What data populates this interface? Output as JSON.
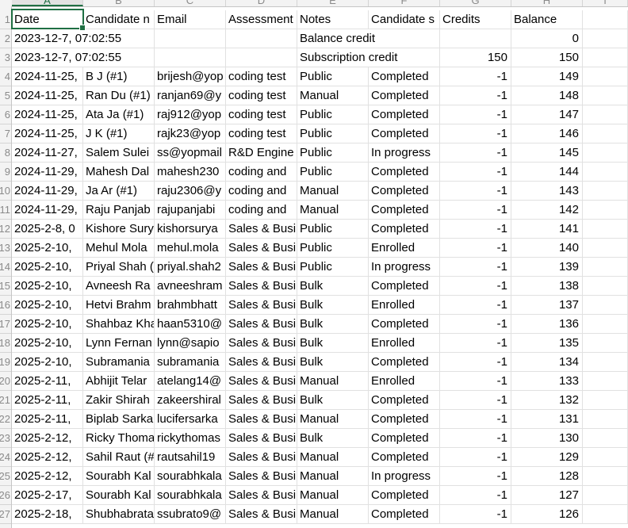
{
  "columns": [
    {
      "letter": "A"
    },
    {
      "letter": "B"
    },
    {
      "letter": "C"
    },
    {
      "letter": "D"
    },
    {
      "letter": "E"
    },
    {
      "letter": "F"
    },
    {
      "letter": "G"
    },
    {
      "letter": "H"
    },
    {
      "letter": "I"
    }
  ],
  "header": {
    "row_number": "1",
    "cells": [
      "Date",
      "Candidate n",
      "Email",
      "Assessment",
      "Notes",
      "Candidate s",
      "Credits",
      "Balance"
    ]
  },
  "rows": [
    {
      "n": "2",
      "cells": [
        "2023-12-7, 07:02:55",
        "",
        "",
        "",
        "Balance credit",
        "",
        "",
        "0"
      ]
    },
    {
      "n": "3",
      "cells": [
        "2023-12-7, 07:02:55",
        "",
        "",
        "",
        "Subscription credit",
        "",
        "150",
        "150"
      ]
    },
    {
      "n": "4",
      "cells": [
        "2024-11-25,",
        "B J (#1)",
        "brijesh@yop",
        "coding test",
        "Public",
        "Completed",
        "-1",
        "149"
      ]
    },
    {
      "n": "5",
      "cells": [
        "2024-11-25,",
        "Ran Du (#1)",
        "ranjan69@y",
        "coding test",
        "Manual",
        "Completed",
        "-1",
        "148"
      ]
    },
    {
      "n": "6",
      "cells": [
        "2024-11-25,",
        "Ata Ja (#1)",
        "raj912@yop",
        "coding test",
        "Public",
        "Completed",
        "-1",
        "147"
      ]
    },
    {
      "n": "7",
      "cells": [
        "2024-11-25,",
        "J K (#1)",
        "rajk23@yop",
        "coding test",
        "Public",
        "Completed",
        "-1",
        "146"
      ]
    },
    {
      "n": "8",
      "cells": [
        "2024-11-27,",
        "Salem Sulei",
        "ss@yopmail",
        "R&D Engine",
        "Public",
        "In progress",
        "-1",
        "145"
      ]
    },
    {
      "n": "9",
      "cells": [
        "2024-11-29,",
        "Mahesh Dal",
        "mahesh230",
        "coding and",
        "Public",
        "Completed",
        "-1",
        "144"
      ]
    },
    {
      "n": "10",
      "cells": [
        "2024-11-29,",
        "Ja Ar (#1)",
        "raju2306@y",
        "coding and",
        "Manual",
        "Completed",
        "-1",
        "143"
      ]
    },
    {
      "n": "11",
      "cells": [
        "2024-11-29,",
        "Raju Panjab",
        "rajupanjabi",
        "coding and",
        "Manual",
        "Completed",
        "-1",
        "142"
      ]
    },
    {
      "n": "12",
      "cells": [
        "2025-2-8, 0",
        "Kishore Sury",
        "kishorsurya",
        "Sales & Busi",
        "Public",
        "Completed",
        "-1",
        "141"
      ]
    },
    {
      "n": "13",
      "cells": [
        "2025-2-10,",
        "Mehul Mola",
        "mehul.mola",
        "Sales & Busi",
        "Public",
        "Enrolled",
        "-1",
        "140"
      ]
    },
    {
      "n": "14",
      "cells": [
        "2025-2-10,",
        "Priyal Shah (",
        "priyal.shah2",
        "Sales & Busi",
        "Public",
        "In progress",
        "-1",
        "139"
      ]
    },
    {
      "n": "15",
      "cells": [
        "2025-2-10,",
        "Avneesh Ra",
        "avneeshram",
        "Sales & Busi",
        "Bulk",
        "Completed",
        "-1",
        "138"
      ]
    },
    {
      "n": "16",
      "cells": [
        "2025-2-10,",
        "Hetvi Brahm",
        "brahmbhatt",
        "Sales & Busi",
        "Bulk",
        "Enrolled",
        "-1",
        "137"
      ]
    },
    {
      "n": "17",
      "cells": [
        "2025-2-10,",
        "Shahbaz Kha",
        "haan5310@",
        "Sales & Busi",
        "Bulk",
        "Completed",
        "-1",
        "136"
      ]
    },
    {
      "n": "18",
      "cells": [
        "2025-2-10,",
        "Lynn Fernan",
        "lynn@sapio",
        "Sales & Busi",
        "Bulk",
        "Enrolled",
        "-1",
        "135"
      ]
    },
    {
      "n": "19",
      "cells": [
        "2025-2-10,",
        "Subramania",
        "subramania",
        "Sales & Busi",
        "Bulk",
        "Completed",
        "-1",
        "134"
      ]
    },
    {
      "n": "20",
      "cells": [
        "2025-2-11,",
        "Abhijit Telar",
        "atelang14@",
        "Sales & Busi",
        "Manual",
        "Enrolled",
        "-1",
        "133"
      ]
    },
    {
      "n": "21",
      "cells": [
        "2025-2-11,",
        "Zakir Shirah",
        "zakeershiral",
        "Sales & Busi",
        "Bulk",
        "Completed",
        "-1",
        "132"
      ]
    },
    {
      "n": "22",
      "cells": [
        "2025-2-11,",
        "Biplab Sarka",
        "lucifersarka",
        "Sales & Busi",
        "Manual",
        "Completed",
        "-1",
        "131"
      ]
    },
    {
      "n": "23",
      "cells": [
        "2025-2-12,",
        "Ricky Thoma",
        "rickythomas",
        "Sales & Busi",
        "Bulk",
        "Completed",
        "-1",
        "130"
      ]
    },
    {
      "n": "24",
      "cells": [
        "2025-2-12,",
        "Sahil Raut (#",
        "rautsahil19",
        "Sales & Busi",
        "Manual",
        "Completed",
        "-1",
        "129"
      ]
    },
    {
      "n": "25",
      "cells": [
        "2025-2-12,",
        "Sourabh Kal",
        "sourabhkala",
        "Sales & Busi",
        "Manual",
        "In progress",
        "-1",
        "128"
      ]
    },
    {
      "n": "26",
      "cells": [
        "2025-2-17,",
        "Sourabh Kal",
        "sourabhkala",
        "Sales & Busi",
        "Manual",
        "Completed",
        "-1",
        "127"
      ]
    },
    {
      "n": "27",
      "cells": [
        "2025-2-18,",
        "Shubhabrata",
        "ssubrato9@",
        "Sales & Busi",
        "Manual",
        "Completed",
        "-1",
        "126"
      ]
    }
  ]
}
